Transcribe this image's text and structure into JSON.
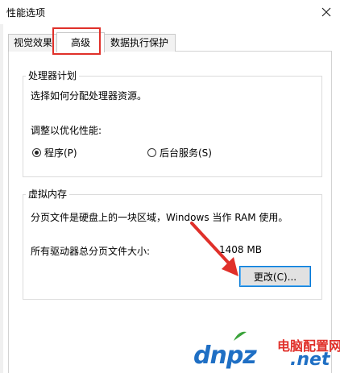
{
  "window": {
    "title": "性能选项"
  },
  "tabs": [
    {
      "label": "视觉效果"
    },
    {
      "label": "高级"
    },
    {
      "label": "数据执行保护"
    }
  ],
  "processor": {
    "legend": "处理器计划",
    "description": "选择如何分配处理器资源。",
    "adjust_label": "调整以优化性能:",
    "option_programs": "程序(P)",
    "option_services": "后台服务(S)",
    "selected": "程序(P)"
  },
  "virtual_memory": {
    "legend": "虚拟内存",
    "description": "分页文件是硬盘上的一块区域，Windows 当作 RAM 使用。",
    "total_label": "所有驱动器总分页文件大小:",
    "total_value": "1408 MB",
    "change_button": "更改(C)..."
  },
  "watermark": {
    "domain": "dnpz",
    "cn_text": "电脑配置网",
    "tld": ".net"
  },
  "colors": {
    "highlight_red": "#e0302a",
    "button_border": "#0078d7",
    "watermark_blue": "#1f6fc4"
  }
}
